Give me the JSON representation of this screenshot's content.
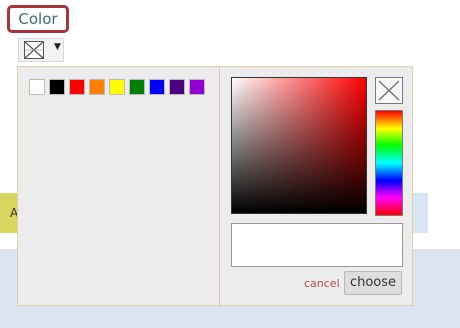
{
  "header": {
    "color_label": "Color"
  },
  "background": {
    "truncated_button_text": "A"
  },
  "picker": {
    "presets": [
      {
        "name": "white",
        "color": "#ffffff"
      },
      {
        "name": "black",
        "color": "#000000"
      },
      {
        "name": "red",
        "color": "#ff0000"
      },
      {
        "name": "orange",
        "color": "#ff7f00"
      },
      {
        "name": "yellow",
        "color": "#ffff00"
      },
      {
        "name": "green",
        "color": "#008000"
      },
      {
        "name": "blue",
        "color": "#0000ff"
      },
      {
        "name": "indigo",
        "color": "#4b0082"
      },
      {
        "name": "violet",
        "color": "#9400d3"
      }
    ],
    "hex_value": "",
    "cancel_label": "cancel",
    "choose_label": "choose",
    "current_hue": "#ff0000"
  }
}
